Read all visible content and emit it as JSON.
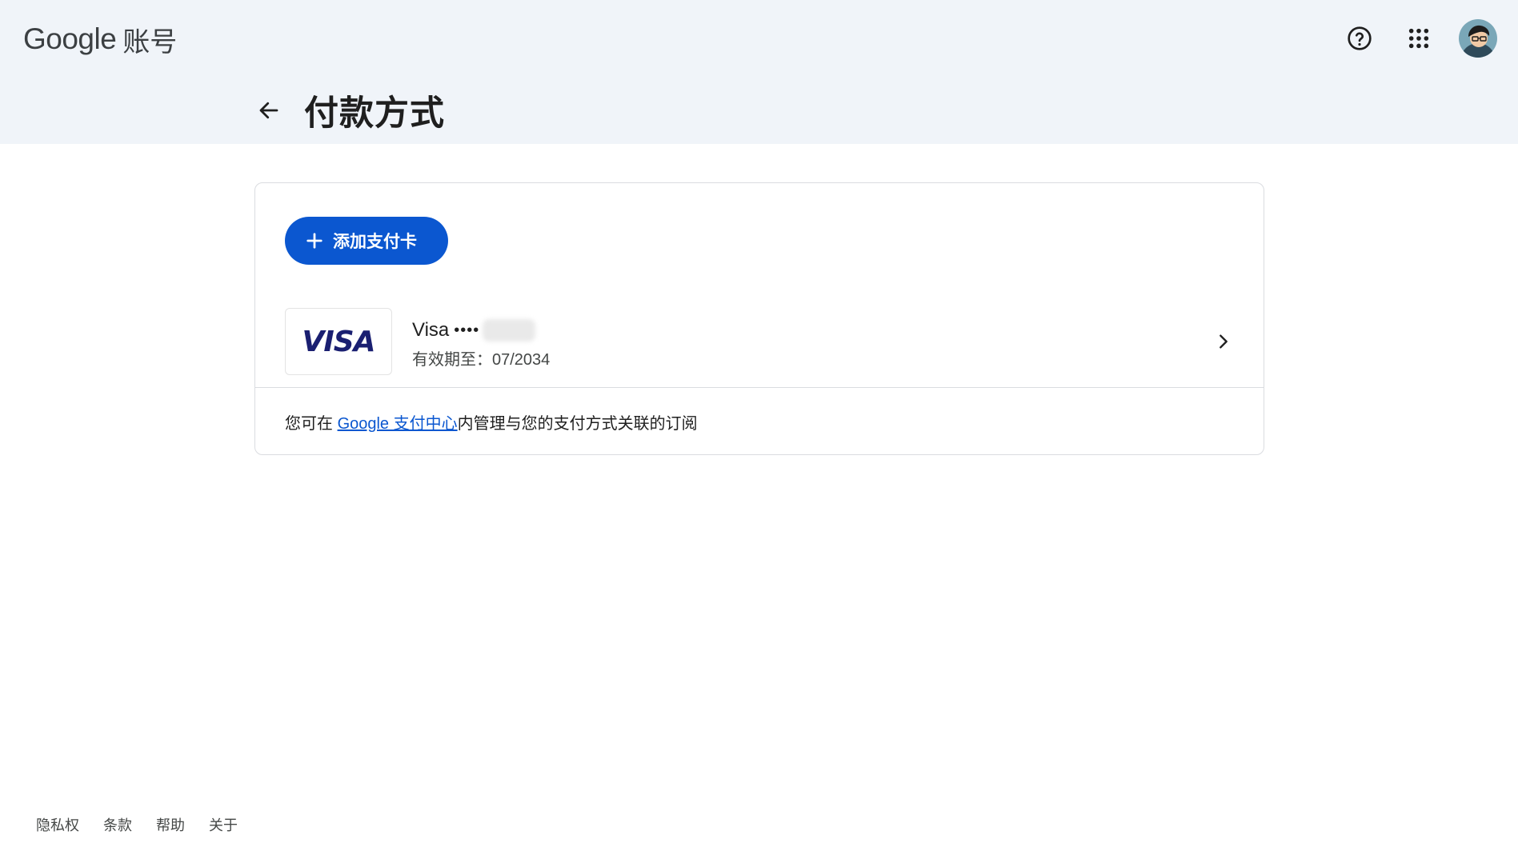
{
  "header": {
    "logo_google": "Google",
    "logo_product": "账号",
    "help_icon": "help-circle-icon",
    "apps_icon": "apps-grid-icon"
  },
  "page": {
    "title": "付款方式"
  },
  "card": {
    "add_button_label": "添加支付卡",
    "payment_method": {
      "brand": "VISA",
      "name": "Visa",
      "masked": "••••",
      "expiry": "有效期至：07/2034"
    },
    "note_prefix": "您可在 ",
    "note_link": "Google 支付中心",
    "note_suffix": "内管理与您的支付方式关联的订阅"
  },
  "footer": {
    "links": [
      "隐私权",
      "条款",
      "帮助",
      "关于"
    ]
  },
  "colors": {
    "primary": "#0b57d0",
    "header_bg": "#f0f4f9",
    "visa_blue": "#1a1f71"
  }
}
